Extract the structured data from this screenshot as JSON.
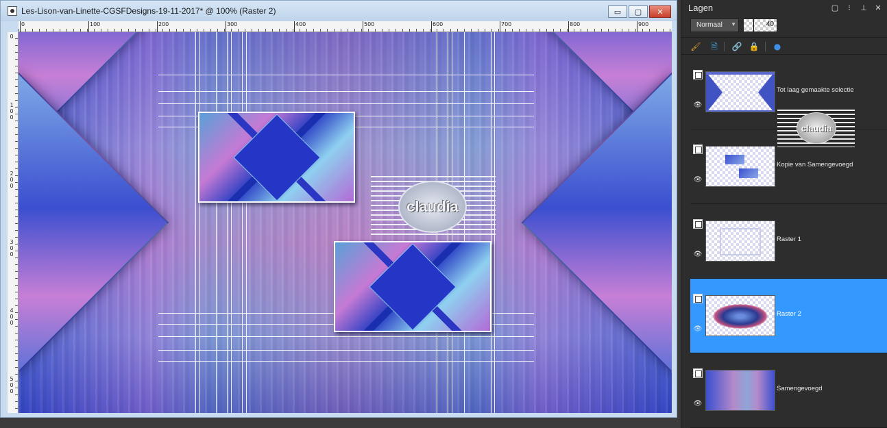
{
  "window": {
    "title": "Les-Lison-van-Linette-CGSFDesigns-19-11-2017* @ 100% (Raster 2)",
    "buttons": {
      "minimize": "▭",
      "maximize": "▢",
      "close": "✕"
    }
  },
  "ruler": {
    "top_ticks": [
      "0",
      "100",
      "200",
      "300",
      "400",
      "500",
      "600",
      "700",
      "800",
      "900"
    ],
    "left_ticks": [
      [
        "0"
      ],
      [
        "1",
        "0",
        "0"
      ],
      [
        "2",
        "0",
        "0"
      ],
      [
        "3",
        "0",
        "0"
      ],
      [
        "4",
        "0",
        "0"
      ],
      [
        "5",
        "0",
        "0"
      ]
    ]
  },
  "canvas": {
    "watermark": "claudia"
  },
  "panel": {
    "title": "Lagen",
    "controls": {
      "restore": "▢",
      "options": "⁝",
      "pin": "⊥",
      "close": "✕"
    },
    "blend_mode": "Normaal",
    "opacity": "40",
    "toolbar": {
      "brush": "🖌",
      "document": "🗎",
      "link": "🔗",
      "lock": "🔒",
      "mask": "●"
    },
    "layers": [
      {
        "name": "Tot laag gemaakte selectie",
        "selected": false
      },
      {
        "name": "Kopie van Samengevoegd",
        "selected": false
      },
      {
        "name": "Raster 1",
        "selected": false
      },
      {
        "name": "Raster 2",
        "selected": true
      },
      {
        "name": "Samengevoegd",
        "selected": false
      }
    ],
    "floating_watermark": "claudia"
  },
  "colors": {
    "panel_bg": "#2d2d2d",
    "selected_layer": "#3399ff",
    "title_bar": "#c9dcef"
  }
}
